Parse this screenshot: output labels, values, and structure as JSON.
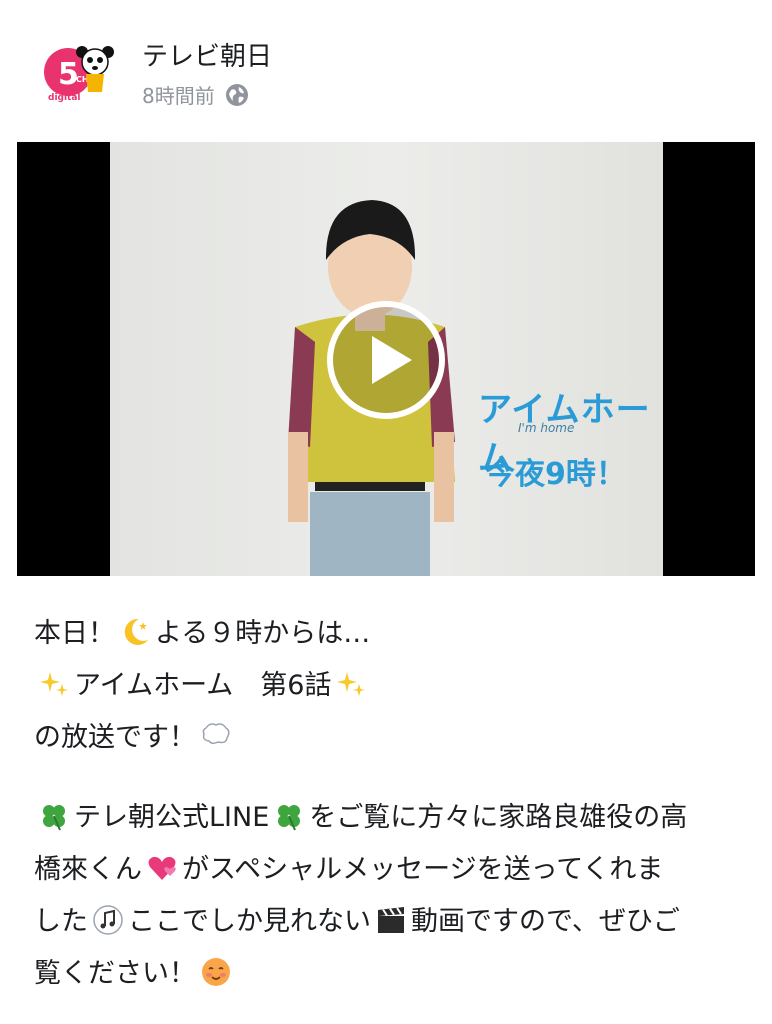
{
  "header": {
    "page_name": "テレビ朝日",
    "timestamp": "8時間前",
    "privacy_icon": "globe-icon",
    "avatar": {
      "badge_text": "5",
      "badge_small": "CH",
      "sub_text": "digital",
      "brand_color": "#e8336e"
    }
  },
  "video": {
    "overlay_title": "アイムホーム",
    "overlay_subtitle": "I'm home",
    "overlay_time": "今夜9時！",
    "play_icon": "play-icon",
    "accent_color": "#2a9bd6"
  },
  "post": {
    "line1_a": "本日！",
    "line1_b": "よる９時からは…",
    "line2": "アイムホーム　第6話",
    "line3": "の放送です！",
    "para2_a": "テレ朝公式LINE",
    "para2_b": "をご覧に方々に家路良雄役の高",
    "para2_c": "橋來くん",
    "para2_d": "がスペシャルメッセージを送ってくれま",
    "para2_e": "した",
    "para2_f": "ここでしか見れない",
    "para2_g": "動画ですので、ぜひご",
    "para2_h": "覧ください！",
    "emoji_icons": [
      "crescent-moon-icon",
      "sparkles-icon",
      "speech-balloon-icon",
      "four-leaf-clover-icon",
      "heart-icon",
      "music-note-icon",
      "clapper-board-icon",
      "smiling-face-icon"
    ]
  }
}
